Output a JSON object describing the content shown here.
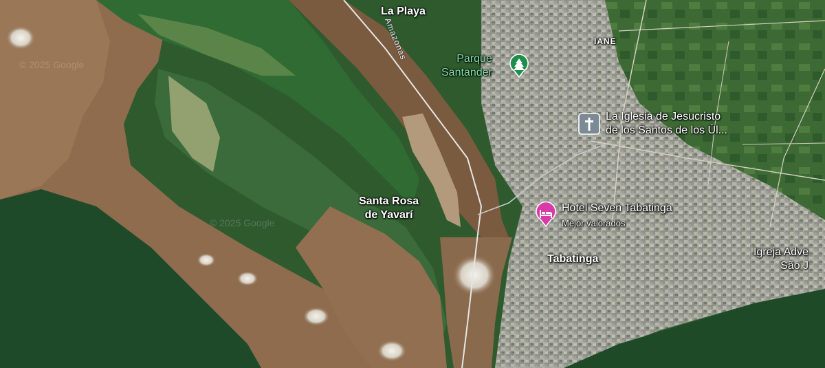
{
  "map": {
    "labels": {
      "la_playa": "La Playa",
      "parque": "Parque\nSantander",
      "iane": "IANE",
      "church": "La Iglesia de Jesucristo\nde los Santos de los Úl...",
      "santa_rosa": "Santa Rosa\nde Yavarí",
      "hotel": "Hotel Seven Tabatinga",
      "hotel_sub": "Mejor valorados",
      "tabatinga": "Tabatinga",
      "igreja": "Igreja Adve\nSão J",
      "river": "Amazonas"
    },
    "watermark": "© 2025 Google",
    "colors": {
      "river": "#8a6a4c",
      "forest": "#1f4a2a",
      "city": "#a7a8a0",
      "park_pin": "#1e8e4a",
      "hotel_pin": "#d93aa8",
      "church_pin": "#7c8a96"
    },
    "icons": [
      "tree-icon",
      "cross-icon",
      "bed-icon"
    ]
  }
}
